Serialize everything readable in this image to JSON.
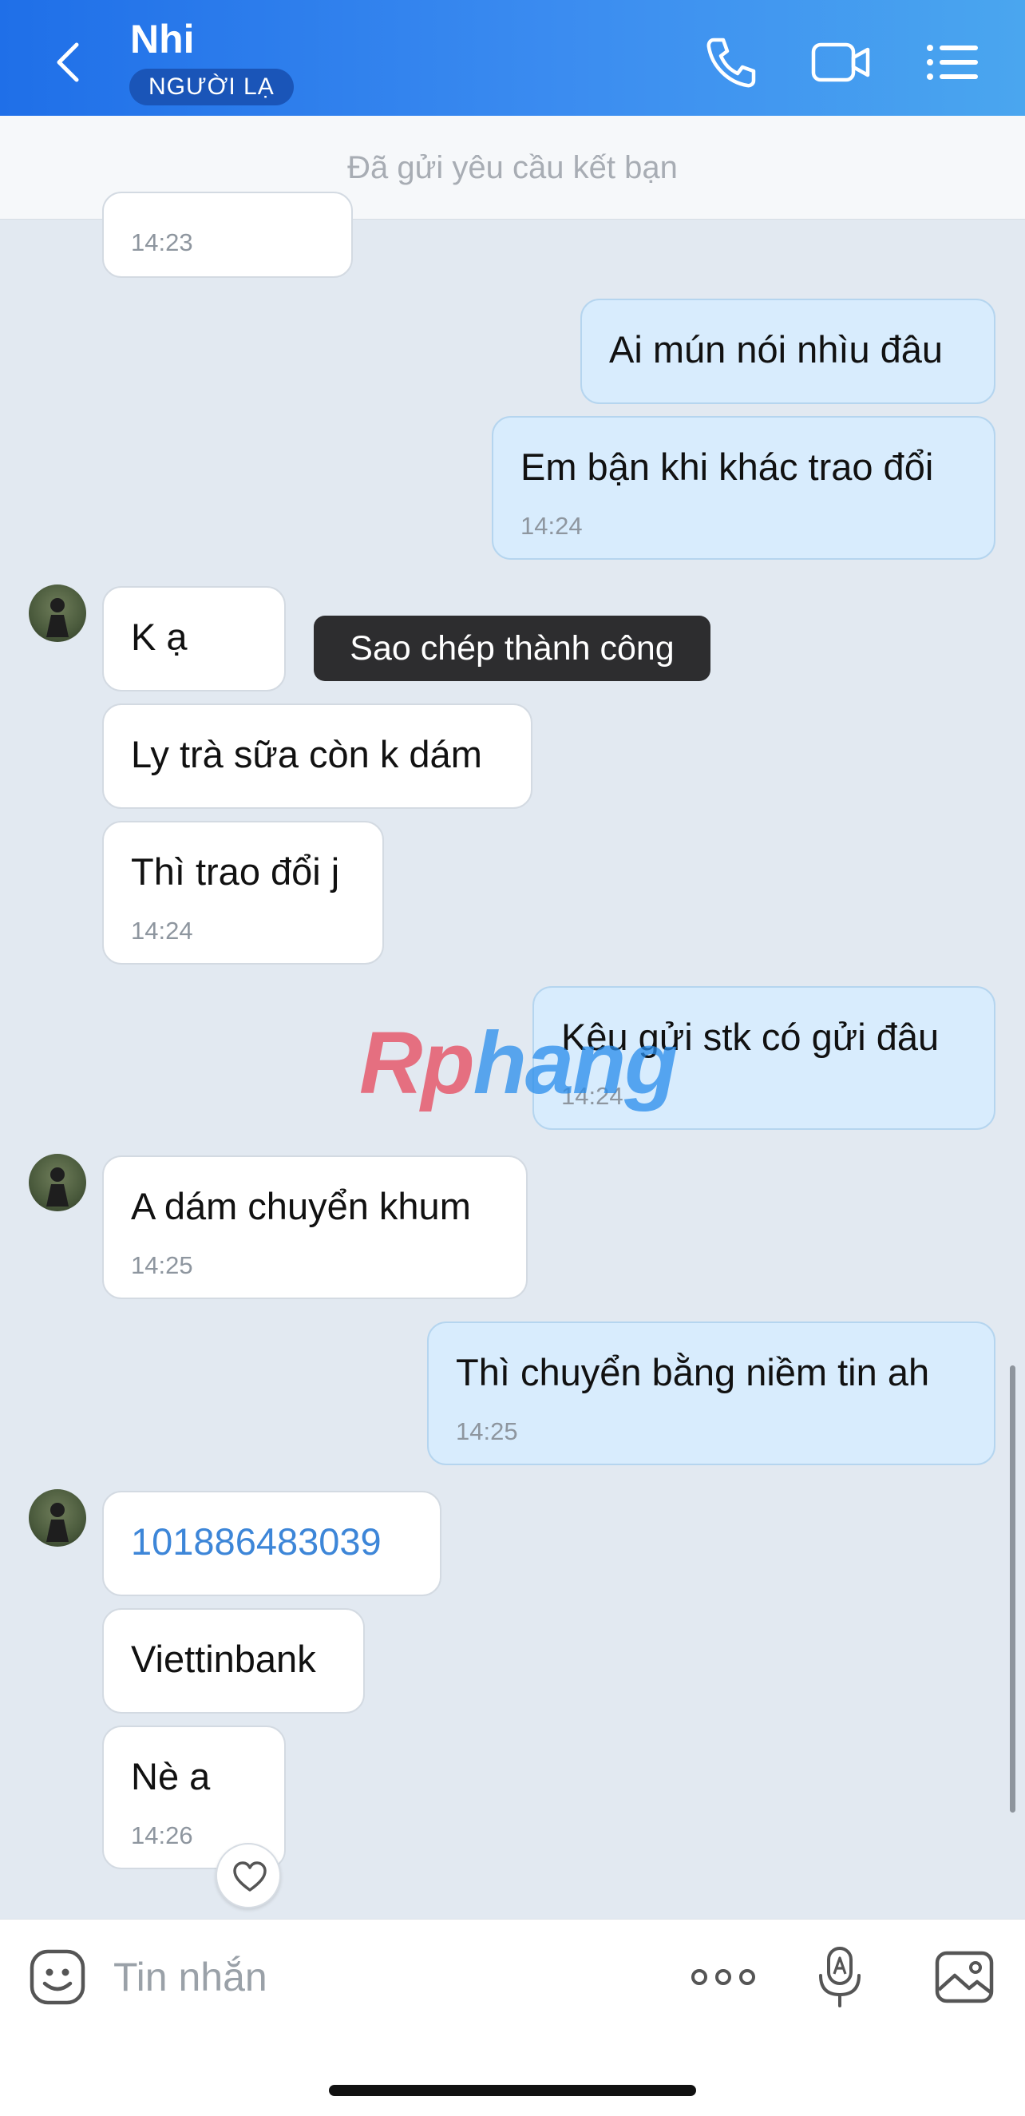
{
  "header": {
    "contact_name": "Nhi",
    "badge": "NGƯỜI LẠ",
    "back_icon": "chevron-left-icon",
    "call_icon": "phone-icon",
    "video_icon": "video-camera-icon",
    "menu_icon": "list-menu-icon",
    "gradient_start": "#1f6fe8",
    "gradient_end": "#4aa6ef"
  },
  "banner": {
    "text": "Đã gửi yêu cầu kết bạn"
  },
  "messages": [
    {
      "dir": "in",
      "text": "",
      "time": "14:23"
    },
    {
      "dir": "out",
      "text": "Ai mún nói nhìu đâu",
      "time": ""
    },
    {
      "dir": "out",
      "text": "Em bận khi khác trao đổi",
      "time": "14:24"
    },
    {
      "dir": "in",
      "text": "K ạ",
      "time": ""
    },
    {
      "dir": "in",
      "text": "Ly trà sữa còn k dám",
      "time": ""
    },
    {
      "dir": "in",
      "text": "Thì trao đổi j",
      "time": "14:24"
    },
    {
      "dir": "out",
      "text": "Kêu gửi stk có gửi đâu",
      "time": "14:24"
    },
    {
      "dir": "in",
      "text": "A dám chuyển khum",
      "time": "14:25"
    },
    {
      "dir": "out",
      "text": "Thì chuyển bằng niềm tin ah",
      "time": "14:25"
    },
    {
      "dir": "in",
      "text": "101886483039",
      "time": "",
      "is_link": true
    },
    {
      "dir": "in",
      "text": "Viettinbank",
      "time": ""
    },
    {
      "dir": "in",
      "text": "Nè a",
      "time": "14:26"
    }
  ],
  "toast": {
    "text": "Sao chép thành công"
  },
  "watermark": {
    "part1": "Rp",
    "part2": "hang"
  },
  "reaction_icon": "heart-icon",
  "composer": {
    "placeholder": "Tin nhắn",
    "sticker_icon": "sticker-face-icon",
    "more_icon": "more-dots-icon",
    "voice_icon": "voice-to-text-icon",
    "image_icon": "image-icon"
  },
  "colors": {
    "outgoing_bubble": "#d8ecfd",
    "incoming_bubble": "#ffffff",
    "chat_background": "#e2e9f1",
    "link": "#3d86d8"
  }
}
